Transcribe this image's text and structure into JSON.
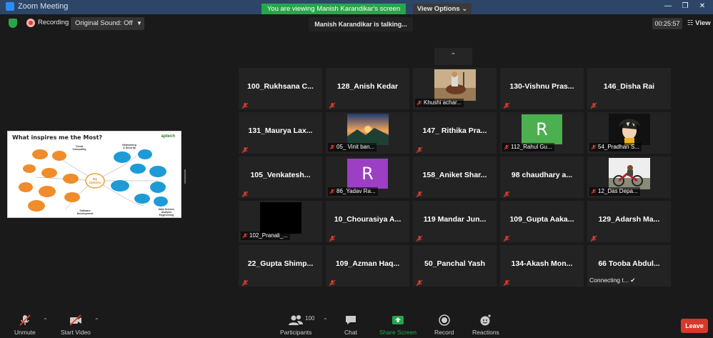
{
  "window": {
    "title": "Zoom Meeting"
  },
  "banner": {
    "sharing_text": "You are viewing Manish Karandikar's screen",
    "view_options": "View Options"
  },
  "toolbar": {
    "recording_label": "Recording",
    "original_sound_label": "Original Sound: Off",
    "talking_text": "Manish Karandikar is talking...",
    "timer": "00:25:57",
    "view_label": "View"
  },
  "shared_screen": {
    "title": "What inspires me the Most?",
    "logo": "aptech",
    "center": "My Options",
    "nodes_left": [
      "Cloud Computing",
      "Networking & Security",
      "Software Development"
    ],
    "nodes_right": [
      "Data Science Analysis Engineering"
    ]
  },
  "gallery": {
    "tiles": [
      {
        "name": "100_Rukhsana C...",
        "kind": "name"
      },
      {
        "name": "128_Anish Kedar",
        "kind": "name"
      },
      {
        "name": "Khushi achar...",
        "kind": "photo",
        "photo": "horse-rider"
      },
      {
        "name": "130-Vishnu Pras...",
        "kind": "name"
      },
      {
        "name": "146_Disha Rai",
        "kind": "name"
      },
      {
        "name": "131_Maurya Lax...",
        "kind": "name"
      },
      {
        "name": "05_ Vinit ban...",
        "kind": "photo",
        "photo": "sunset"
      },
      {
        "name": "147_ Rithika Pra...",
        "kind": "name"
      },
      {
        "name": "112_Rahul Gu...",
        "kind": "avatar",
        "initial": "R",
        "color": "#4caf50"
      },
      {
        "name": "54_Pradhan S...",
        "kind": "photo",
        "photo": "anime"
      },
      {
        "name": "105_Venkatesh...",
        "kind": "name"
      },
      {
        "name": "86_Yadav Ra...",
        "kind": "avatar",
        "initial": "R",
        "color": "#9c3fc4"
      },
      {
        "name": "158_Aniket Shar...",
        "kind": "name"
      },
      {
        "name": "98 chaudhary a...",
        "kind": "name"
      },
      {
        "name": "12_Das Depa...",
        "kind": "photo",
        "photo": "bike"
      },
      {
        "name": "102_Pranali_...",
        "kind": "photo",
        "photo": "black"
      },
      {
        "name": "10_Chourasiya A...",
        "kind": "name"
      },
      {
        "name": "119 Mandar Jun...",
        "kind": "name"
      },
      {
        "name": "109_Gupta Aaka...",
        "kind": "name"
      },
      {
        "name": "129_Adarsh Ma...",
        "kind": "name"
      },
      {
        "name": "22_Gupta Shimp...",
        "kind": "name"
      },
      {
        "name": "109_Azman Haq...",
        "kind": "name"
      },
      {
        "name": "50_Panchal Yash",
        "kind": "name"
      },
      {
        "name": "134-Akash Mon...",
        "kind": "name"
      },
      {
        "name": "66 Tooba Abdul...",
        "kind": "connecting",
        "status": "Connecting t..."
      }
    ]
  },
  "bottom": {
    "unmute": "Unmute",
    "start_video": "Start Video",
    "participants": "Participants",
    "participants_count": "100",
    "chat": "Chat",
    "share_screen": "Share Screen",
    "record": "Record",
    "reactions": "Reactions",
    "leave": "Leave"
  },
  "colors": {
    "share_green": "#27a54a",
    "leave_red": "#d9372b",
    "mute_red": "#e43d30"
  }
}
